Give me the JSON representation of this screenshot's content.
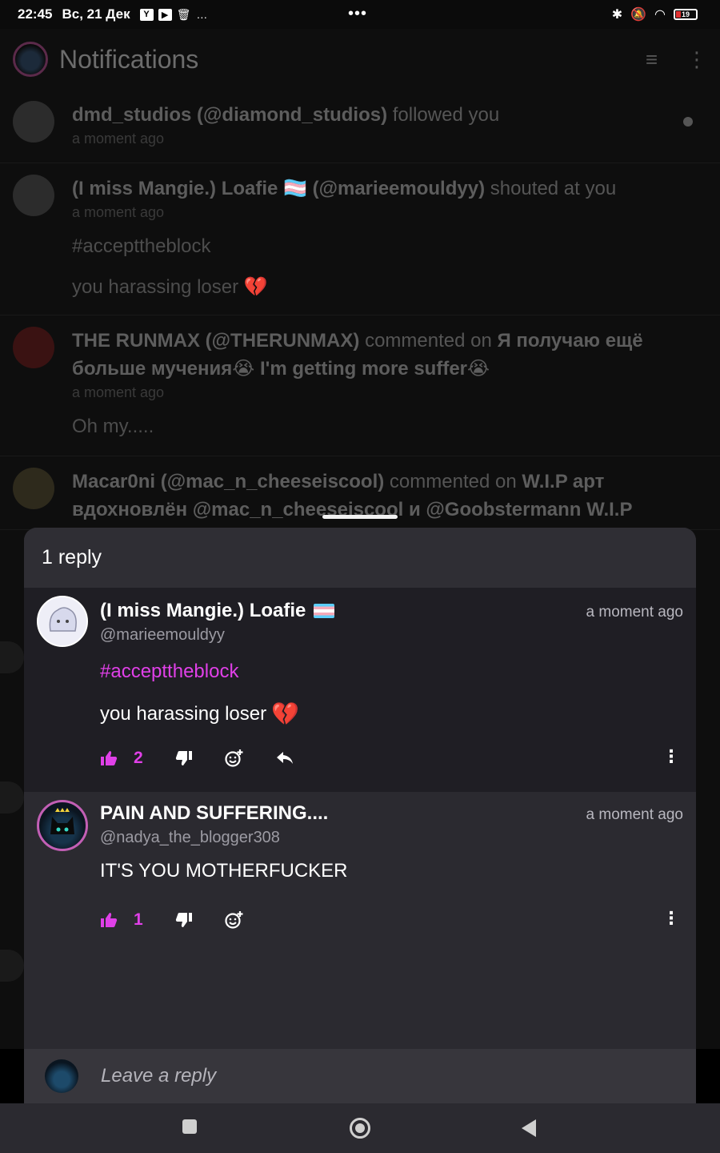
{
  "status_bar": {
    "time": "22:45",
    "date": "Вс, 21 Дек",
    "more_dots": "…",
    "center_dots": "•••",
    "battery": "19"
  },
  "app": {
    "title": "Notifications"
  },
  "notifications": [
    {
      "actor": "dmd_studios (@diamond_studios)",
      "action": "followed you",
      "time": "a moment ago",
      "unread": true
    },
    {
      "actor": "(I miss Mangie.) Loafie 🏳️‍⚧️ (@marieemouldyy)",
      "action": "shouted at you",
      "time": "a moment ago",
      "tag": "#accepttheblock",
      "body": "you harassing loser 💔"
    },
    {
      "actor": "THE RUNMAX (@THERUNMAX)",
      "action": "commented on",
      "target": "Я получаю ещё больше мучения😭 I'm getting more suffer😭",
      "time": "a moment ago",
      "body": "Oh my....."
    },
    {
      "actor": "Macar0ni (@mac_n_cheeseiscool)",
      "action": "commented on",
      "target": "W.I.P арт вдохновлён @mac_n_cheeseiscool и @Goobstermann W.I.P"
    }
  ],
  "sheet": {
    "title": "1 reply",
    "replies": [
      {
        "name": "(I miss Mangie.) Loafie",
        "handle": "@marieemouldyy",
        "time": "a moment ago",
        "tag": "#accepttheblock",
        "text": "you harassing loser",
        "emoji": "💔",
        "likes": "2"
      },
      {
        "name": "PAIN AND SUFFERING....",
        "handle": "@nadya_the_blogger308",
        "time": "a moment ago",
        "text": "IT'S YOU MOTHERFUCKER",
        "likes": "1"
      }
    ],
    "composer": {
      "placeholder": "Leave a reply"
    }
  },
  "colors": {
    "accent": "#e040e8",
    "sheet_bg": "#2b2a30",
    "first_reply_bg": "#1f1e24"
  },
  "icons": {
    "like": "thumb-up-icon",
    "dislike": "thumb-down-icon",
    "react": "add-reaction-icon",
    "reply": "reply-icon",
    "more": "more-vertical-icon"
  }
}
